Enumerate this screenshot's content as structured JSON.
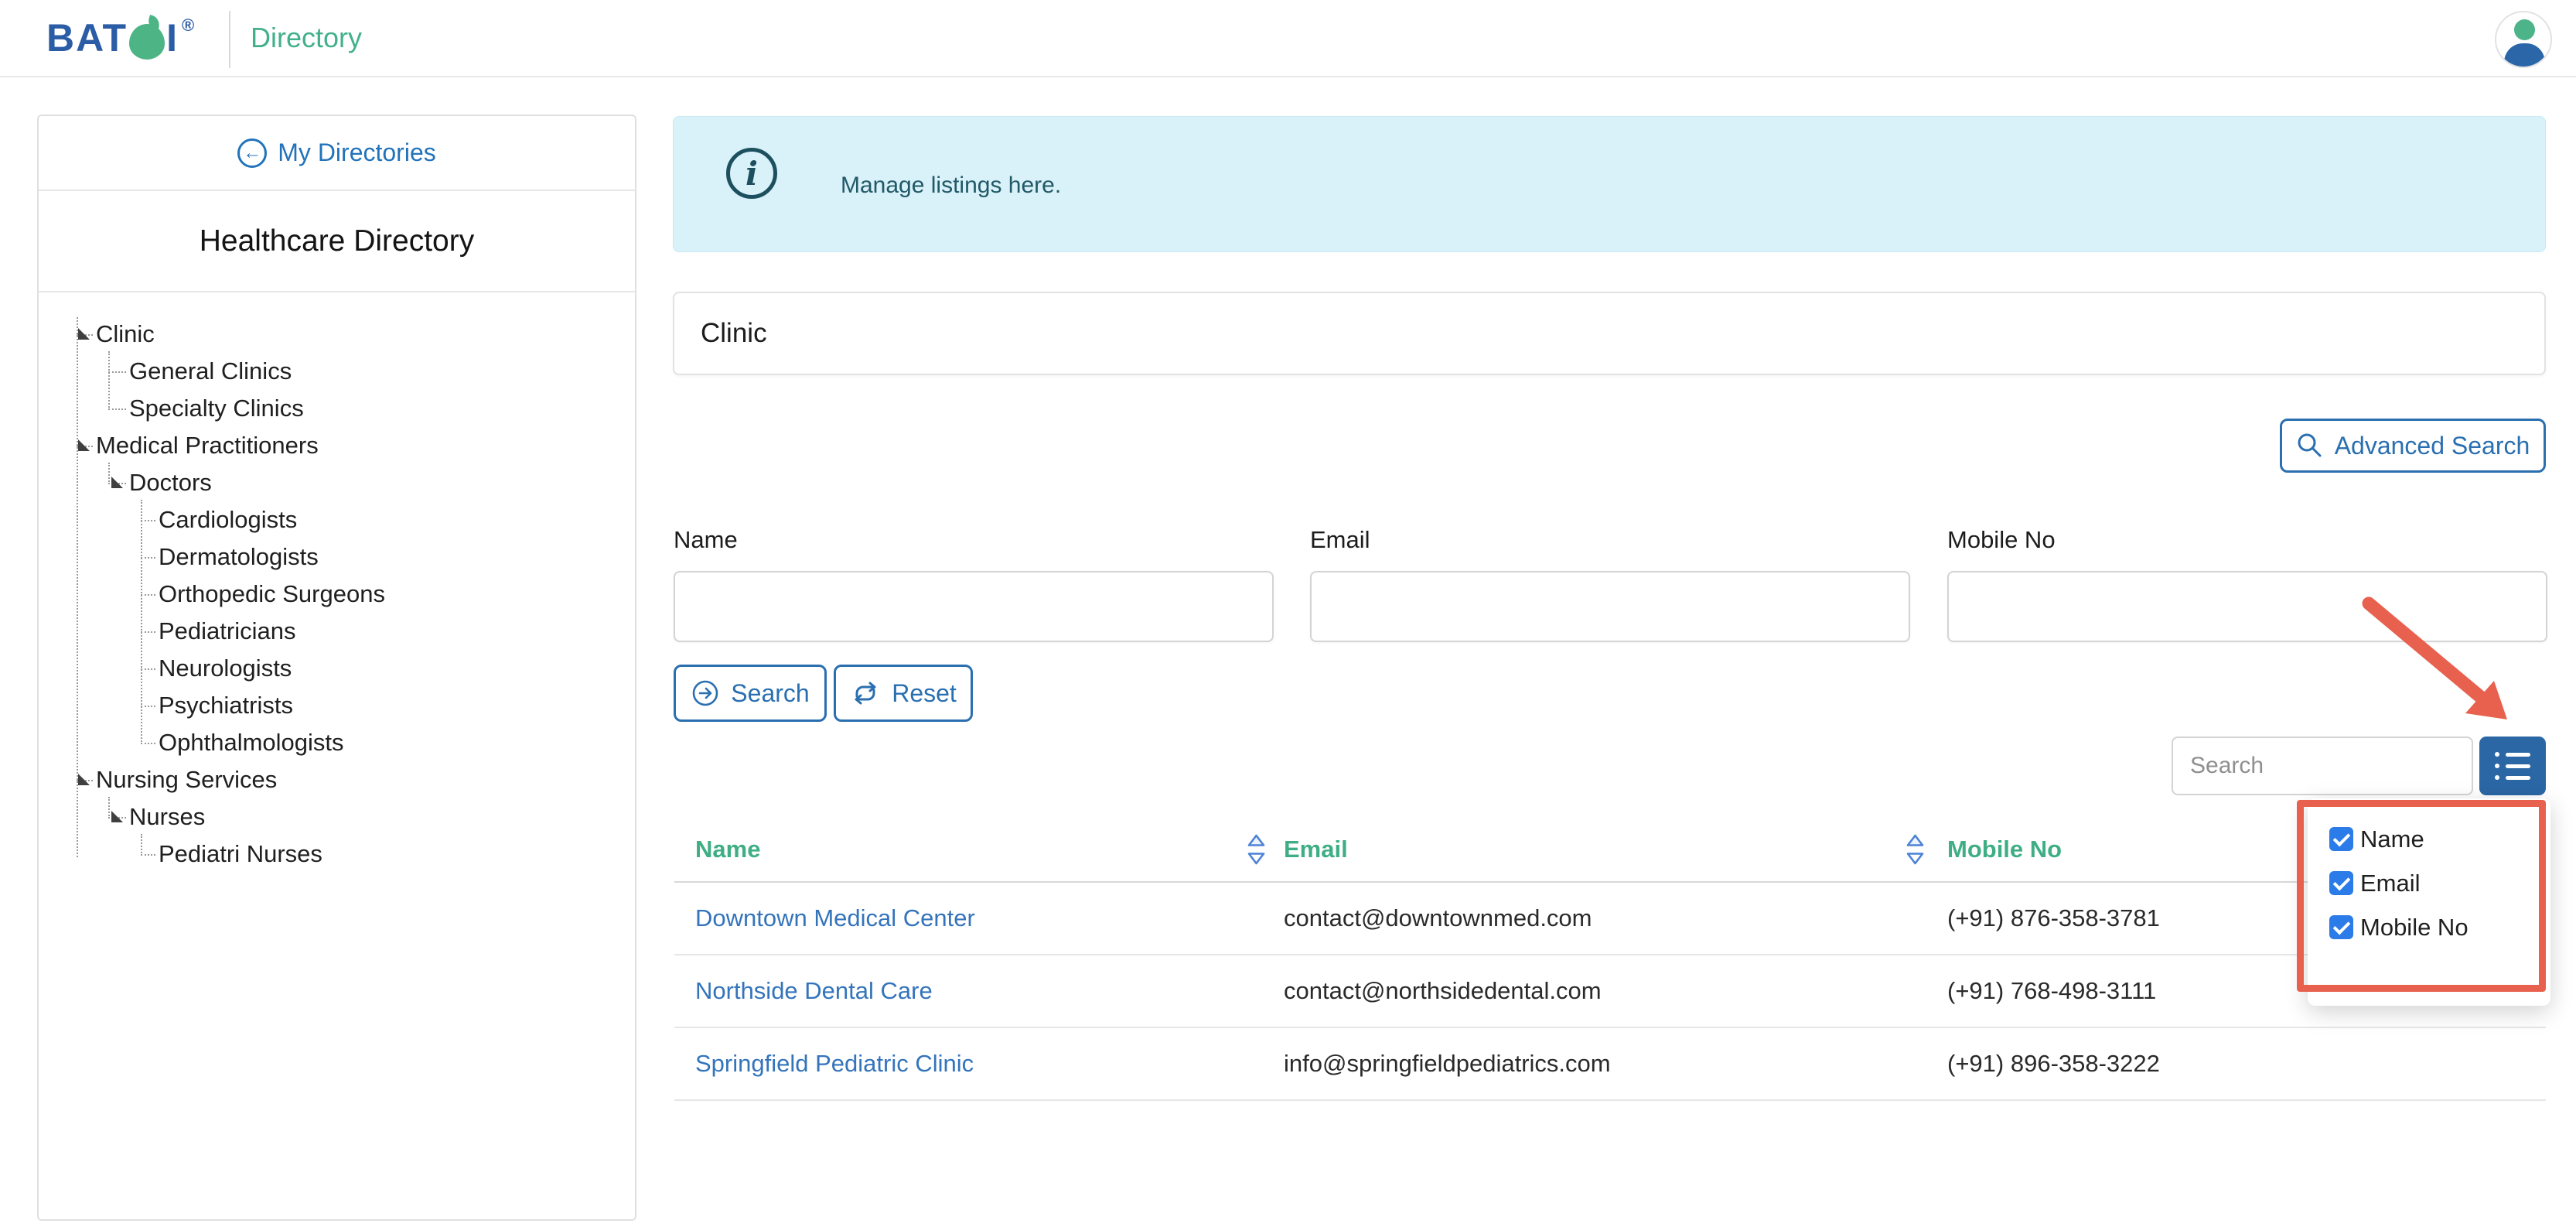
{
  "header": {
    "logo_part1": "BAT",
    "logo_part2": "I",
    "logo_reg": "®",
    "app_title": "Directory"
  },
  "sidebar": {
    "back_label": "My Directories",
    "title": "Healthcare Directory",
    "tree": [
      {
        "label": "Clinic",
        "level": 0,
        "expandable": true
      },
      {
        "label": "General Clinics",
        "level": 1,
        "expandable": false
      },
      {
        "label": "Specialty Clinics",
        "level": 1,
        "expandable": false
      },
      {
        "label": "Medical Practitioners",
        "level": 0,
        "expandable": true
      },
      {
        "label": "Doctors",
        "level": 1,
        "expandable": true
      },
      {
        "label": "Cardiologists",
        "level": 2,
        "expandable": false
      },
      {
        "label": "Dermatologists",
        "level": 2,
        "expandable": false
      },
      {
        "label": "Orthopedic Surgeons",
        "level": 2,
        "expandable": false
      },
      {
        "label": "Pediatricians",
        "level": 2,
        "expandable": false
      },
      {
        "label": "Neurologists",
        "level": 2,
        "expandable": false
      },
      {
        "label": "Psychiatrists",
        "level": 2,
        "expandable": false
      },
      {
        "label": "Ophthalmologists",
        "level": 2,
        "expandable": false
      },
      {
        "label": "Nursing Services",
        "level": 0,
        "expandable": true
      },
      {
        "label": "Nurses",
        "level": 1,
        "expandable": true
      },
      {
        "label": "Pediatri Nurses",
        "level": 2,
        "expandable": false
      }
    ]
  },
  "banner": {
    "text": "Manage listings here."
  },
  "filter": {
    "directory_label": "Clinic",
    "advanced_search_label": "Advanced Search",
    "fields": [
      {
        "label": "Name",
        "value": "",
        "placeholder": ""
      },
      {
        "label": "Email",
        "value": "",
        "placeholder": ""
      },
      {
        "label": "Mobile No",
        "value": "",
        "placeholder": ""
      }
    ],
    "search_label": "Search",
    "reset_label": "Reset"
  },
  "list_controls": {
    "search_placeholder": "Search",
    "columns_menu": [
      {
        "label": "Name",
        "checked": true
      },
      {
        "label": "Email",
        "checked": true
      },
      {
        "label": "Mobile No",
        "checked": true
      }
    ]
  },
  "table": {
    "headers": [
      {
        "label": "Name",
        "sortable": true
      },
      {
        "label": "Email",
        "sortable": true
      },
      {
        "label": "Mobile No",
        "sortable": false
      }
    ],
    "rows": [
      {
        "name": "Downtown Medical Center",
        "email": "contact@downtownmed.com",
        "mobile": "(+91) 876-358-3781"
      },
      {
        "name": "Northside Dental Care",
        "email": "contact@northsidedental.com",
        "mobile": "(+91) 768-498-3111"
      },
      {
        "name": "Springfield Pediatric Clinic",
        "email": "info@springfieldpediatrics.com",
        "mobile": "(+91) 896-358-3222"
      }
    ]
  },
  "colors": {
    "brand_blue": "#2b5ca6",
    "brand_green": "#4cb485",
    "title_green": "#43b08c",
    "header_green": "#3fae85",
    "link_blue": "#3474bb",
    "button_blue": "#2a6fb0",
    "square_button_blue": "#2b67a5",
    "checkbox_blue": "#2b7ce9",
    "banner_bg": "#d9f1f8",
    "banner_text": "#215968",
    "annotation_red": "#e8614e"
  }
}
